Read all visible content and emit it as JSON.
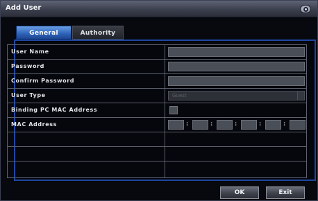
{
  "window": {
    "title": "Add User"
  },
  "tabs": [
    {
      "label": "General",
      "active": true
    },
    {
      "label": "Authority",
      "active": false
    }
  ],
  "form": {
    "rows": [
      {
        "label": "User Name",
        "value": ""
      },
      {
        "label": "Password",
        "value": ""
      },
      {
        "label": "Confirm Password",
        "value": ""
      },
      {
        "label": "User Type",
        "value": "Guest"
      },
      {
        "label": "Binding PC MAC Address",
        "checked": false
      },
      {
        "label": "MAC Address",
        "segments": [
          "",
          "",
          "",
          "",
          "",
          ""
        ]
      }
    ]
  },
  "footer": {
    "ok_label": "OK",
    "exit_label": "Exit"
  },
  "colors": {
    "accent": "#1e46a2",
    "tab_active": "#2d62b8",
    "field_bg": "#4a4e56"
  }
}
